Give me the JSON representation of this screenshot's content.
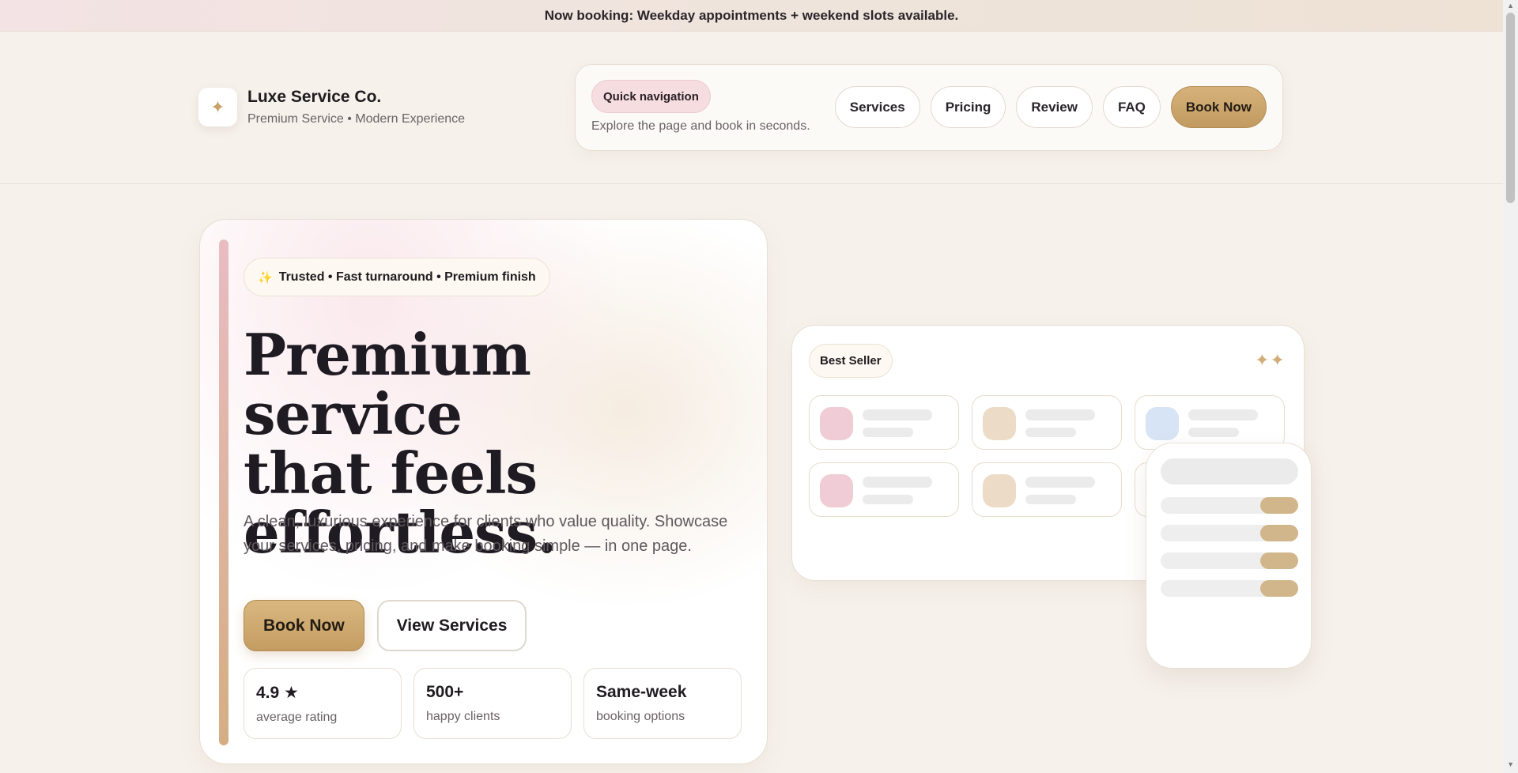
{
  "announcement": {
    "text": "Now booking: Weekday appointments + weekend slots available."
  },
  "brand": {
    "mark": "✦",
    "name": "Luxe Service Co.",
    "tagline": "Premium Service • Modern Experience"
  },
  "quick_nav": {
    "chip": "Quick navigation",
    "subtitle": "Explore the page and book in seconds.",
    "links": [
      "Services",
      "Pricing",
      "Review",
      "FAQ"
    ],
    "book_label": "Book Now"
  },
  "hero": {
    "trust_icon": "✨",
    "trust_text": "Trusted • Fast turnaround • Premium finish",
    "title_line1": "Premium service",
    "title_line2": "that feels",
    "title_line3": "effortless.",
    "description": "A clean, luxurious experience for clients who value quality. Showcase your services, pricing, and make booking simple — in one page.",
    "primary_button": "Book Now",
    "secondary_button": "View Services",
    "stats": [
      {
        "value": "4.9 ★",
        "label": "average rating"
      },
      {
        "value": "500+",
        "label": "happy clients"
      },
      {
        "value": "Same-week",
        "label": "booking options"
      }
    ]
  },
  "preview": {
    "chip": "Best Seller",
    "sparkles": "✦✦",
    "tile_colors": [
      "#f0cdd6",
      "#ecdcc7",
      "#d7e4f5",
      "#f0cdd6",
      "#ecdcc7"
    ]
  },
  "colors": {
    "accent_gold": "#c9a268",
    "accent_pink": "#f6dde0",
    "background": "#f6f1eb"
  }
}
